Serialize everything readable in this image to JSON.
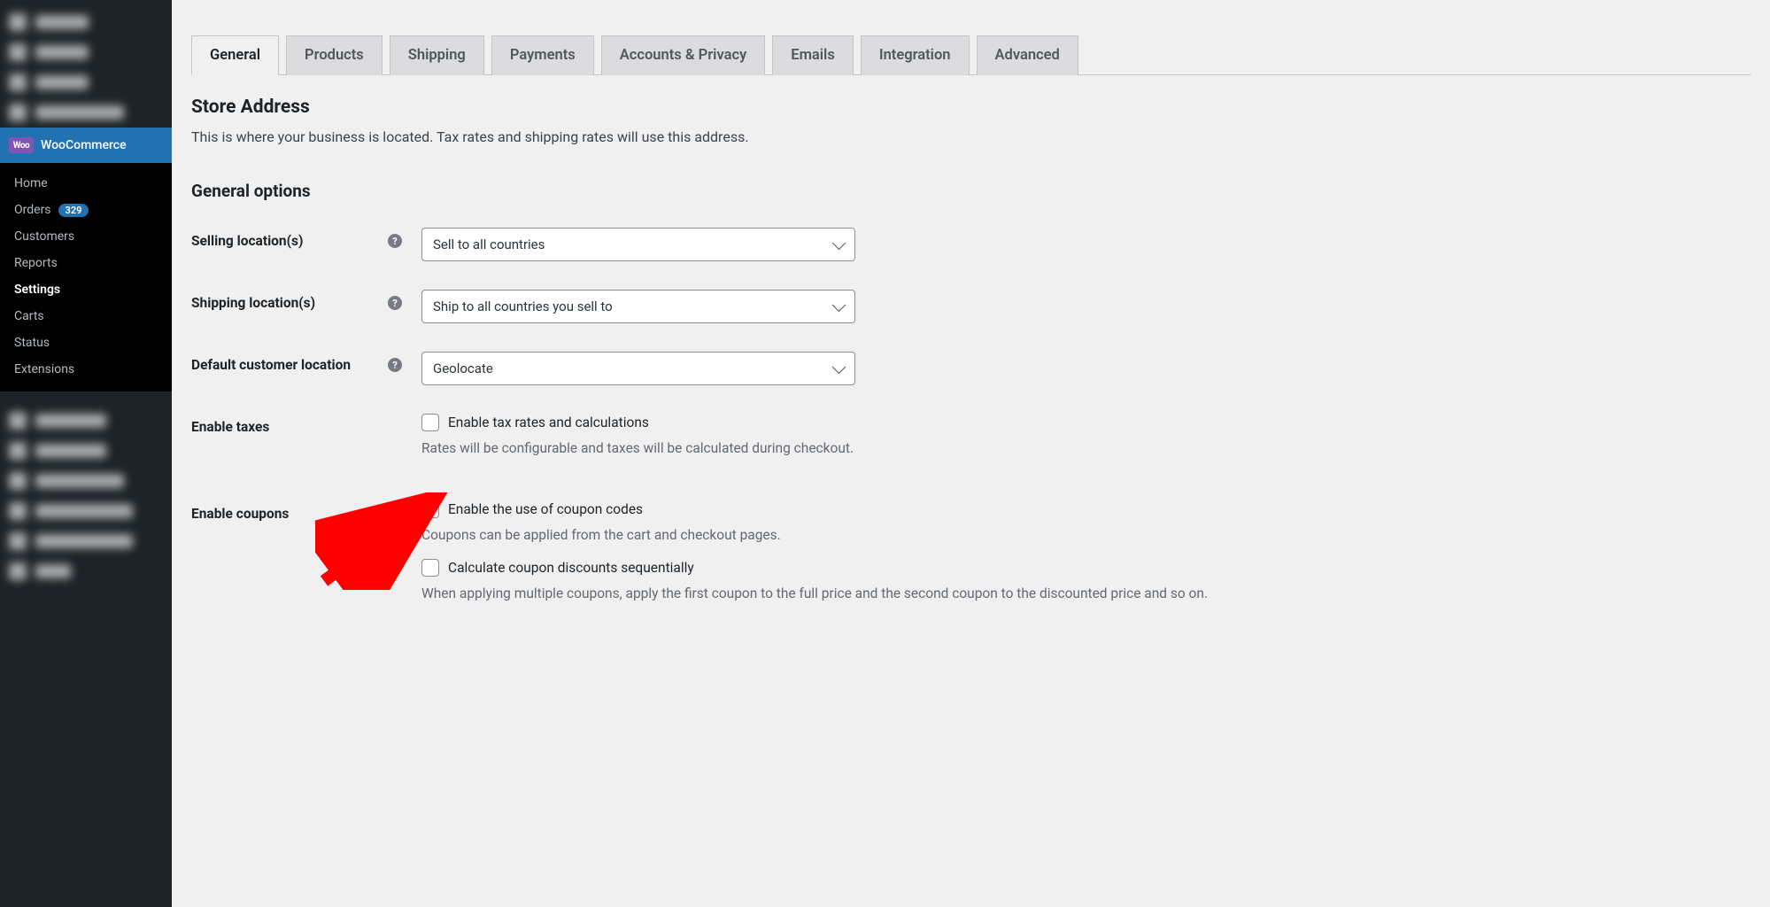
{
  "sidebar": {
    "main_label": "WooCommerce",
    "sub": [
      {
        "label": "Home"
      },
      {
        "label": "Orders",
        "count": "329"
      },
      {
        "label": "Customers"
      },
      {
        "label": "Reports"
      },
      {
        "label": "Settings",
        "current": true
      },
      {
        "label": "Carts"
      },
      {
        "label": "Status"
      },
      {
        "label": "Extensions"
      }
    ]
  },
  "tabs": [
    {
      "label": "General",
      "active": true
    },
    {
      "label": "Products"
    },
    {
      "label": "Shipping"
    },
    {
      "label": "Payments"
    },
    {
      "label": "Accounts & Privacy"
    },
    {
      "label": "Emails"
    },
    {
      "label": "Integration"
    },
    {
      "label": "Advanced"
    }
  ],
  "store_address": {
    "title": "Store Address",
    "desc": "This is where your business is located. Tax rates and shipping rates will use this address."
  },
  "general_options": {
    "title": "General options",
    "rows": {
      "selling_locations": {
        "label": "Selling location(s)",
        "value": "Sell to all countries"
      },
      "shipping_locations": {
        "label": "Shipping location(s)",
        "value": "Ship to all countries you sell to"
      },
      "default_customer_location": {
        "label": "Default customer location",
        "value": "Geolocate"
      },
      "enable_taxes": {
        "label": "Enable taxes",
        "checkbox_label": "Enable tax rates and calculations",
        "checked": false,
        "help": "Rates will be configurable and taxes will be calculated during checkout."
      },
      "enable_coupons": {
        "label": "Enable coupons",
        "cb1_label": "Enable the use of coupon codes",
        "cb1_checked": true,
        "cb1_help": "Coupons can be applied from the cart and checkout pages.",
        "cb2_label": "Calculate coupon discounts sequentially",
        "cb2_checked": false,
        "cb2_help": "When applying multiple coupons, apply the first coupon to the full price and the second coupon to the discounted price and so on."
      }
    }
  }
}
